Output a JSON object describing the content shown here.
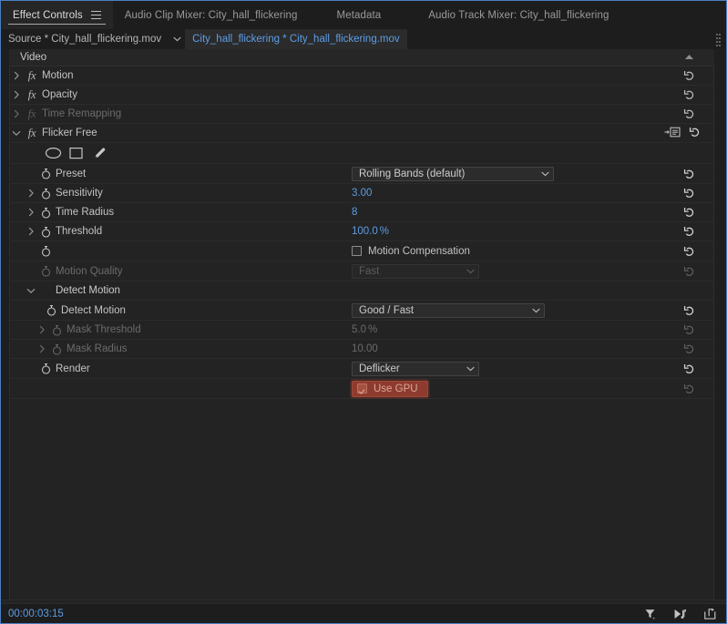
{
  "app": {
    "accent_blue": "#5d9ce6",
    "panel_bg": "#232323",
    "highlight_red": "#8d3b2e"
  },
  "tabs": [
    {
      "label": "Effect Controls",
      "active": true,
      "menu_icon": "panel-menu-icon"
    },
    {
      "label": "Audio Clip Mixer: City_hall_flickering",
      "active": false
    },
    {
      "label": "Metadata",
      "active": false
    },
    {
      "label": "Audio Track Mixer: City_hall_flickering",
      "active": false
    }
  ],
  "sourcebar": {
    "source_label": "Source * City_hall_flickering.mov",
    "caret_icon": "chevron-down-icon",
    "selected_clip": "City_hall_flickering * City_hall_flickering.mov",
    "grip_icon": "drag-grip-icon"
  },
  "video_section": {
    "label": "Video",
    "collapse_icon": "triangle-up-icon"
  },
  "effects": [
    {
      "name": "Motion",
      "twisty": "chevron-right-icon",
      "expanded": false,
      "enabled": true,
      "fx_icon": "fx-icon",
      "reset_icon": "reset-icon"
    },
    {
      "name": "Opacity",
      "twisty": "chevron-right-icon",
      "expanded": false,
      "enabled": true,
      "fx_icon": "fx-icon",
      "reset_icon": "reset-icon"
    },
    {
      "name": "Time Remapping",
      "twisty": "chevron-right-icon",
      "expanded": false,
      "enabled": false,
      "fx_icon": "fx-icon",
      "reset_icon": "reset-icon"
    },
    {
      "name": "Flicker Free",
      "twisty": "chevron-down-icon",
      "expanded": true,
      "enabled": true,
      "fx_icon": "fx-icon",
      "mask_ref_icon": "mask-reference-icon",
      "reset_icon": "reset-icon"
    }
  ],
  "mask_tools": [
    {
      "icon": "ellipse-mask-icon",
      "name": "create-ellipse-mask"
    },
    {
      "icon": "rectangle-mask-icon",
      "name": "create-rectangle-mask"
    },
    {
      "icon": "pen-mask-icon",
      "name": "free-draw-bezier"
    }
  ],
  "properties": [
    {
      "label": "Preset",
      "control": "dropdown",
      "value": "Rolling Bands (default)",
      "width": "wide",
      "twisty": null,
      "stopwatch": true,
      "indent": 1,
      "disabled": false
    },
    {
      "label": "Sensitivity",
      "control": "number",
      "value": "3.00",
      "twisty": "chevron-right-icon",
      "stopwatch": true,
      "indent": 1,
      "disabled": false
    },
    {
      "label": "Time Radius",
      "control": "number",
      "value": "8",
      "twisty": "chevron-right-icon",
      "stopwatch": true,
      "indent": 1,
      "disabled": false
    },
    {
      "label": "Threshold",
      "control": "number",
      "value": "100.0",
      "unit": "%",
      "twisty": "chevron-right-icon",
      "stopwatch": true,
      "indent": 1,
      "disabled": false
    },
    {
      "label": "",
      "control": "checkbox",
      "checkbox_label": "Motion Compensation",
      "checked": false,
      "twisty": null,
      "stopwatch": true,
      "indent": 1,
      "disabled": false
    },
    {
      "label": "Motion Quality",
      "control": "dropdown",
      "value": "Fast",
      "width": "narrow",
      "twisty": null,
      "stopwatch": true,
      "indent": 1,
      "disabled": true
    }
  ],
  "detect_motion_group": {
    "label": "Detect Motion",
    "twisty": "chevron-down-icon",
    "expanded": true,
    "children": [
      {
        "label": "Detect Motion",
        "control": "dropdown",
        "value": "Good / Fast",
        "width": "mid",
        "twisty": null,
        "stopwatch": true,
        "indent": 2,
        "disabled": false
      },
      {
        "label": "Mask Threshold",
        "control": "number",
        "value": "5.0",
        "unit": "%",
        "twisty": "chevron-right-icon",
        "stopwatch": true,
        "indent": 2,
        "disabled": true
      },
      {
        "label": "Mask Radius",
        "control": "number",
        "value": "10.00",
        "twisty": "chevron-right-icon",
        "stopwatch": true,
        "indent": 2,
        "disabled": true
      }
    ]
  },
  "render_property": {
    "label": "Render",
    "control": "dropdown",
    "value": "Deflicker",
    "width": "narrow",
    "stopwatch": true,
    "indent": 1,
    "disabled": false
  },
  "gpu_property": {
    "checkbox_label": "Use GPU",
    "checked": true,
    "highlighted": true,
    "disabled": true
  },
  "bottom_bar": {
    "timecode": "00:00:03:15",
    "icons": [
      {
        "name": "filter-funnel-icon"
      },
      {
        "name": "play-audio-icon"
      },
      {
        "name": "export-frame-icon"
      }
    ]
  }
}
